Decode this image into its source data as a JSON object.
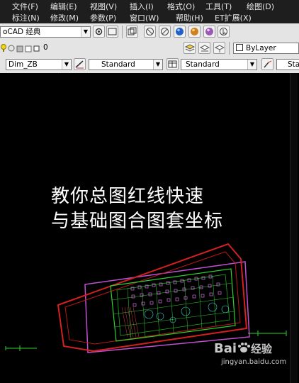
{
  "menus": {
    "row1": [
      "文件(F)",
      "编辑(E)",
      "视图(V)",
      "插入(I)",
      "格式(O)",
      "工具(T)",
      "绘图(D)"
    ],
    "row2": [
      "标注(N)",
      "修改(M)",
      "参数(P)",
      "窗口(W)",
      "帮助(H)",
      "ET扩展(X)"
    ]
  },
  "workspace": {
    "value": "oCAD 经典"
  },
  "layer": {
    "value": "0"
  },
  "color": {
    "value": "ByLayer"
  },
  "styles": {
    "dim_style": "Dim_ZB",
    "text_style": "Standard",
    "table_style": "Standard",
    "multileader_style": "Star"
  },
  "caption": {
    "line1": "教你总图红线快速",
    "line2": "与基础图合图套坐标"
  },
  "watermark": {
    "brand_bai": "Bai",
    "brand_text": "经验",
    "url": "jingyan.baidu.com"
  },
  "colors": {
    "red_line": "#d42020",
    "magenta_line": "#c050d0",
    "green_line": "#2ed12e",
    "canvas_bg": "#000000"
  }
}
